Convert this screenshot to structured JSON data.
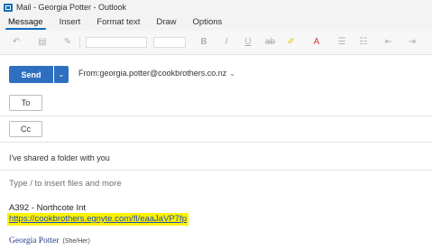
{
  "window": {
    "title": "Mail - Georgia Potter - Outlook"
  },
  "tabs": [
    {
      "label": "Message",
      "active": true
    },
    {
      "label": "Insert",
      "active": false
    },
    {
      "label": "Format text",
      "active": false
    },
    {
      "label": "Draw",
      "active": false
    },
    {
      "label": "Options",
      "active": false
    }
  ],
  "ribbon": {
    "icons": [
      "undo-icon",
      "paste-icon",
      "format-painter-icon",
      "font-name-field",
      "font-size-field",
      "bold-icon",
      "italic-icon",
      "underline-icon",
      "strikethrough-icon",
      "highlight-icon",
      "font-color-icon",
      "bullets-icon",
      "numbering-icon",
      "indent-icon"
    ]
  },
  "compose": {
    "send_label": "Send",
    "from_label": "From:",
    "from_value": "georgia.potter@cookbrothers.co.nz",
    "to_label": "To",
    "cc_label": "Cc",
    "subject": "I've shared a folder with you",
    "body_hint": "Type / to insert files and more",
    "body_title": "A392 - Northcote Int",
    "body_link": "https://cookbrothers.egnyte.com/fl/eaaJaVP7fp",
    "signature_name": "Georgia Potter",
    "signature_pronouns": "(She/Her)"
  },
  "colors": {
    "accent": "#2f6fbf",
    "highlight": "#fff200",
    "link": "#1f4eb5"
  }
}
